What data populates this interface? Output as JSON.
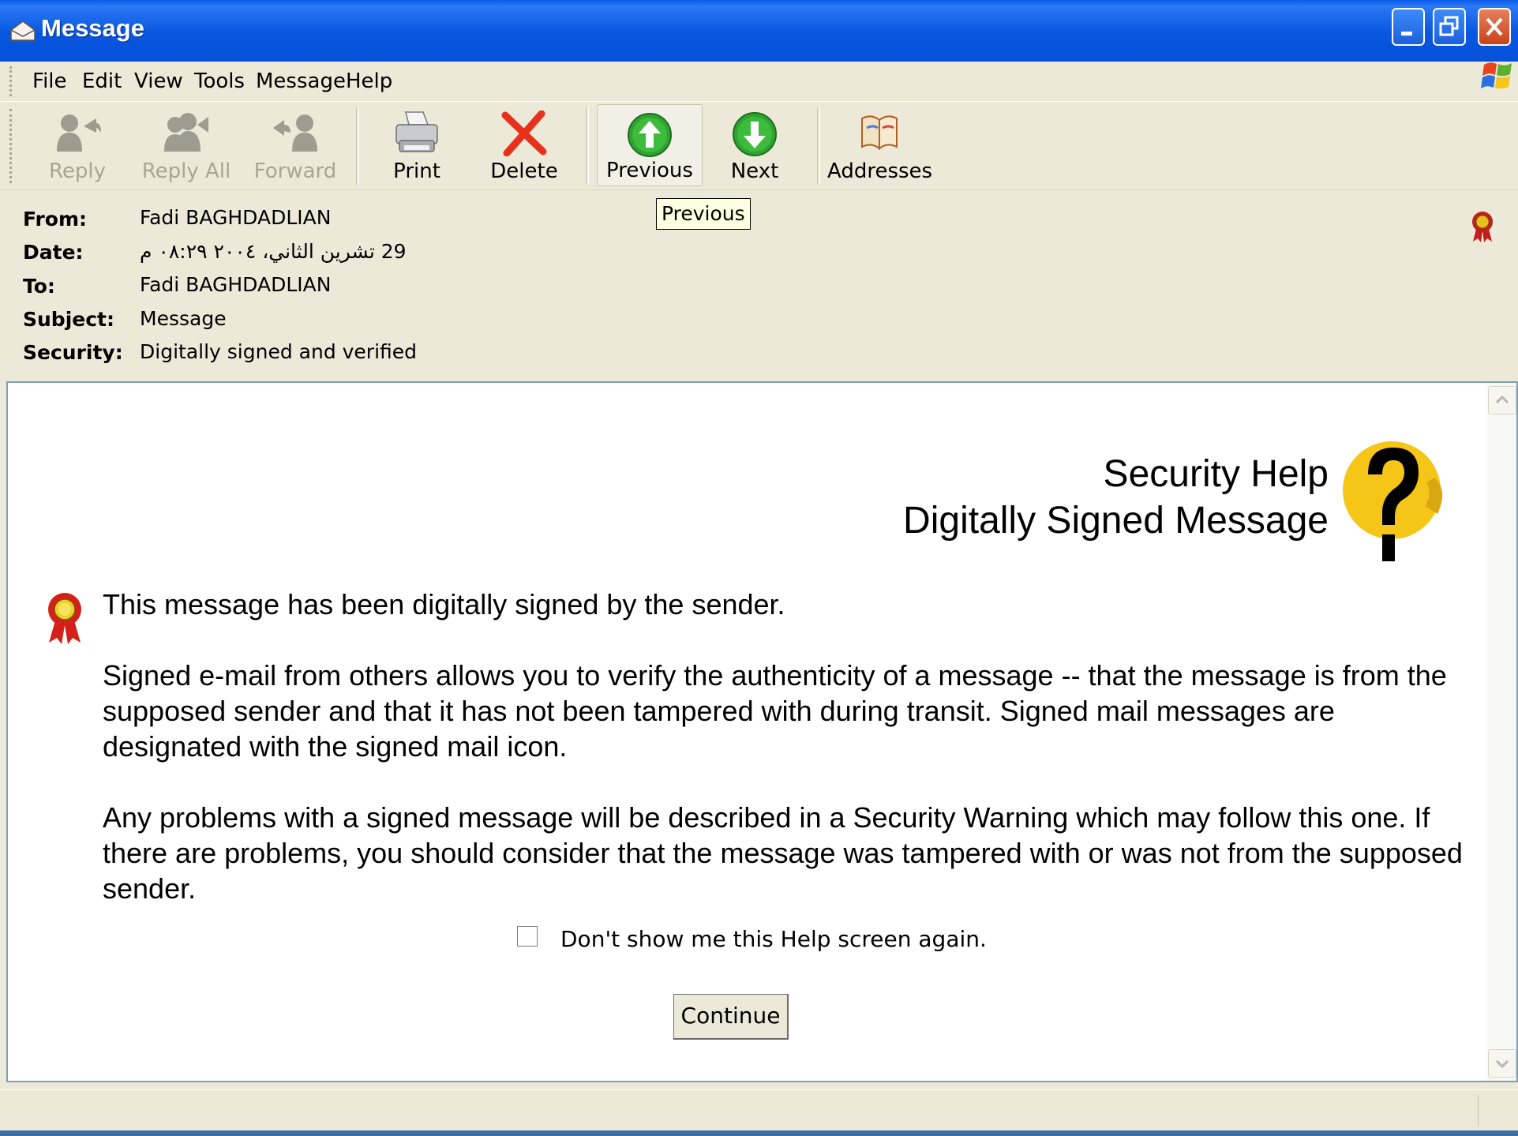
{
  "window": {
    "title": "Message",
    "controls": [
      "minimize",
      "restore",
      "close"
    ]
  },
  "menu": {
    "items": [
      "File",
      "Edit",
      "View",
      "Tools",
      "Message",
      "Help"
    ]
  },
  "toolbar": {
    "buttons": [
      {
        "label": "Reply",
        "icon": "reply-icon",
        "enabled": false
      },
      {
        "label": "Reply All",
        "icon": "reply-all-icon",
        "enabled": false
      },
      {
        "label": "Forward",
        "icon": "forward-icon",
        "enabled": false
      },
      {
        "label": "Print",
        "icon": "printer-icon",
        "enabled": true
      },
      {
        "label": "Delete",
        "icon": "delete-x-icon",
        "enabled": true
      },
      {
        "label": "Previous",
        "icon": "up-arrow-icon",
        "enabled": true
      },
      {
        "label": "Next",
        "icon": "down-arrow-icon",
        "enabled": true
      },
      {
        "label": "Addresses",
        "icon": "address-book-icon",
        "enabled": true
      }
    ],
    "tooltip": "Previous"
  },
  "header": {
    "from_label": "From:",
    "from": "Fadi BAGHDADLIAN",
    "date_label": "Date:",
    "date": "29 تشرين الثاني، ٢٠٠٤ ٠٨:٢٩ م",
    "to_label": "To:",
    "to": "Fadi BAGHDADLIAN",
    "subject_label": "Subject:",
    "subject": "Message",
    "security_label": "Security:",
    "security": "Digitally signed and verified"
  },
  "help": {
    "title": "Security Help",
    "subtitle": "Digitally Signed Message",
    "intro": "This message has been digitally signed by the sender.",
    "para1": "Signed e-mail from others allows you to verify the authenticity of a message -- that the message is from the supposed sender and that it has not been tampered with during transit. Signed mail messages are designated with the signed mail icon.",
    "para2": "Any problems with a signed message will be described in a Security Warning which may follow this one. If there are problems, you should consider that the message was tampered with or was not from the supposed sender.",
    "checkbox_label": "Don't show me this Help screen again.",
    "checkbox_checked": false,
    "continue_label": "Continue"
  },
  "colors": {
    "titlebar": "#0A5BEA",
    "chrome": "#ECE9D8",
    "delete_red": "#E8311A",
    "nav_green": "#2FA32F",
    "help_yellow": "#F5C518"
  }
}
